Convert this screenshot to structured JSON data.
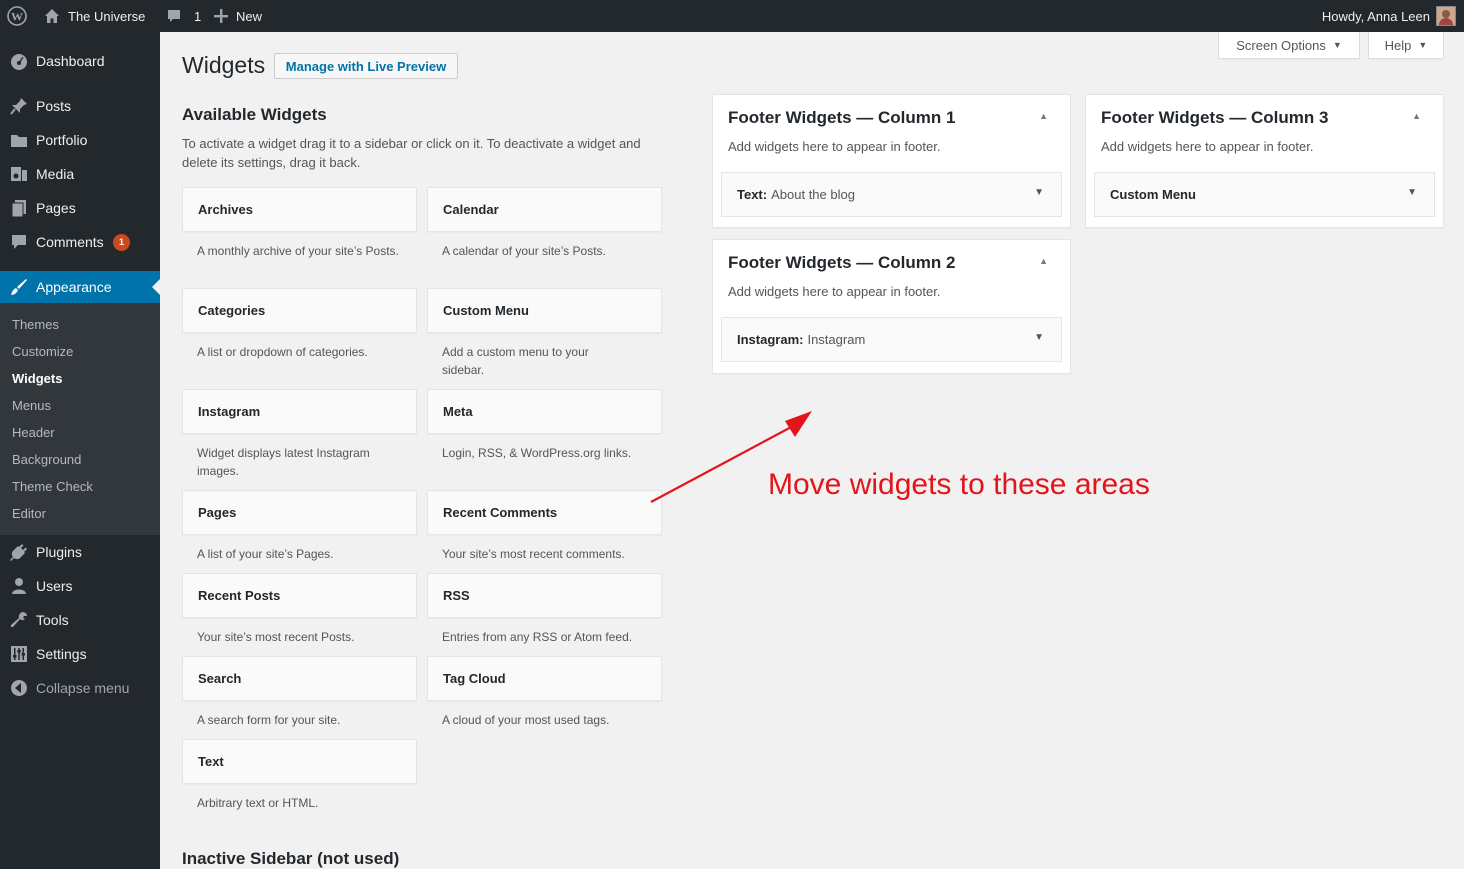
{
  "adminbar": {
    "site_name": "The Universe",
    "comments_count": "1",
    "new_label": "New",
    "howdy": "Howdy, Anna Leen"
  },
  "sidebar": {
    "items": [
      {
        "label": "Dashboard",
        "icon": "dashboard-icon"
      },
      {
        "label": "Posts",
        "icon": "pin-icon"
      },
      {
        "label": "Portfolio",
        "icon": "folder-icon"
      },
      {
        "label": "Media",
        "icon": "media-icon"
      },
      {
        "label": "Pages",
        "icon": "page-icon"
      },
      {
        "label": "Comments",
        "icon": "comment-icon",
        "badge": "1"
      },
      {
        "label": "Appearance",
        "icon": "brush-icon"
      },
      {
        "label": "Plugins",
        "icon": "plug-icon"
      },
      {
        "label": "Users",
        "icon": "user-icon"
      },
      {
        "label": "Tools",
        "icon": "wrench-icon"
      },
      {
        "label": "Settings",
        "icon": "settings-icon"
      },
      {
        "label": "Collapse menu",
        "icon": "collapse-icon"
      }
    ],
    "submenu": [
      "Themes",
      "Customize",
      "Widgets",
      "Menus",
      "Header",
      "Background",
      "Theme Check",
      "Editor"
    ]
  },
  "screen_options": "Screen Options",
  "help": "Help",
  "page_title": "Widgets",
  "live_preview": "Manage with Live Preview",
  "available": {
    "title": "Available Widgets",
    "description": "To activate a widget drag it to a sidebar or click on it. To deactivate a widget and delete its settings, drag it back.",
    "widgets": [
      {
        "title": "Archives",
        "desc": "A monthly archive of your site’s Posts."
      },
      {
        "title": "Calendar",
        "desc": "A calendar of your site’s Posts."
      },
      {
        "title": "Categories",
        "desc": "A list or dropdown of categories."
      },
      {
        "title": "Custom Menu",
        "desc": "Add a custom menu to your sidebar."
      },
      {
        "title": "Instagram",
        "desc": "Widget displays latest Instagram images."
      },
      {
        "title": "Meta",
        "desc": "Login, RSS, & WordPress.org links."
      },
      {
        "title": "Pages",
        "desc": "A list of your site’s Pages."
      },
      {
        "title": "Recent Comments",
        "desc": "Your site’s most recent comments."
      },
      {
        "title": "Recent Posts",
        "desc": "Your site’s most recent Posts."
      },
      {
        "title": "RSS",
        "desc": "Entries from any RSS or Atom feed."
      },
      {
        "title": "Search",
        "desc": "A search form for your site."
      },
      {
        "title": "Tag Cloud",
        "desc": "A cloud of your most used tags."
      },
      {
        "title": "Text",
        "desc": "Arbitrary text or HTML."
      }
    ]
  },
  "areas": [
    {
      "title": "Footer Widgets — Column 1",
      "desc": "Add widgets here to appear in footer.",
      "widget_type": "Text:",
      "widget_name": "About the blog"
    },
    {
      "title": "Footer Widgets — Column 2",
      "desc": "Add widgets here to appear in footer.",
      "widget_type": "Instagram:",
      "widget_name": "Instagram"
    },
    {
      "title": "Footer Widgets — Column 3",
      "desc": "Add widgets here to appear in footer.",
      "widget_type": "Custom Menu",
      "widget_name": ""
    }
  ],
  "inactive_title": "Inactive Sidebar (not used)",
  "annotation": "Move widgets to these areas",
  "colors": {
    "accent": "#0073aa",
    "annotation": "#e3151a",
    "badge": "#ca4a1f"
  }
}
